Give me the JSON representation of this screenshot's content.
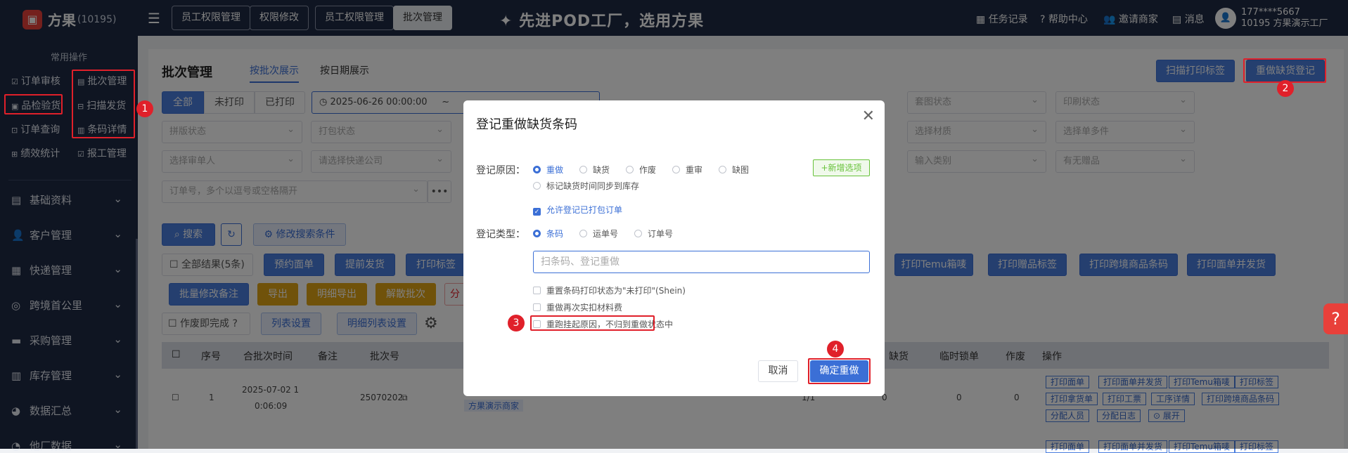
{
  "topbar": {
    "brand": "方果",
    "brand_id": "(10195)",
    "tabs": [
      "员工权限管理",
      "权限修改",
      "员工权限管理",
      "批次管理"
    ],
    "banner": "先进POD工厂，选用方果",
    "task_record": "任务记录",
    "help_center": "帮助中心",
    "invite": "邀请商家",
    "messages": "消息",
    "user_phone": "177****5667",
    "user_company": "10195  方果演示工厂"
  },
  "sidebar": {
    "section_title": "常用操作",
    "quick": [
      "订单审核",
      "批次管理",
      "品检验货",
      "扫描发货",
      "订单查询",
      "条码详情",
      "绩效统计",
      "报工管理"
    ],
    "menu": [
      "基础资料",
      "客户管理",
      "快递管理",
      "跨境首公里",
      "采购管理",
      "库存管理",
      "数据汇总",
      "他厂数据"
    ]
  },
  "page": {
    "title": "批次管理",
    "subtabs": [
      "按批次展示",
      "按日期展示"
    ],
    "btn_scan_print": "扫描打印标签",
    "btn_redo": "重做缺货登记",
    "status_tabs": [
      "全部",
      "未打印",
      "已打印"
    ],
    "date_from": "2025-06-26 00:00:00",
    "date_sep": "~",
    "filters_row1": [
      "套图状态",
      "印刷状态"
    ],
    "filters_row2": [
      "拼版状态",
      "打包状态",
      "选择材质",
      "选择单多件"
    ],
    "filters_row3": [
      "选择审单人",
      "请选择快递公司",
      "输入类别",
      "有无赠品"
    ],
    "order_input_placeholder": "订单号，多个以逗号或空格隔开",
    "more": "•••",
    "search": "搜索",
    "modify_search": "修改搜索条件",
    "select_all": "全部结果(5条)",
    "actions_row1": [
      "预约面单",
      "提前发货",
      "打印标签"
    ],
    "actions_row1_right": [
      "打印Temu箱唛",
      "打印赠品标签",
      "打印跨境商品条码",
      "打印面单并发货"
    ],
    "batch_remark": "批量修改备注",
    "yellow": [
      "导出",
      "明细导出",
      "解散批次"
    ],
    "partial": "分",
    "void_done": "作废即完成",
    "list_settings": "列表设置",
    "detail_settings": "明细列表设置",
    "columns": [
      "序号",
      "合批次时间",
      "备注",
      "批次号",
      "缺货",
      "临时锁单",
      "作废",
      "操作"
    ],
    "row": {
      "index": "1",
      "time1": "2025-07-02 1",
      "time2": "0:06:09",
      "batch_no": "25070202",
      "merchant": "方果演示商家",
      "ratio": "1/1",
      "v1": "0",
      "v2": "0",
      "v3": "0",
      "ops": [
        "打印面单",
        "打印面单并发货",
        "打印Temu箱唛",
        "打印标签",
        "打印拿货单",
        "打印工票",
        "工序详情",
        "打印跨境商品条码",
        "分配人员",
        "分配日志",
        "展开"
      ]
    },
    "next_ops": [
      "打印面单",
      "打印面单并发货",
      "打印Temu箱唛",
      "打印标签"
    ]
  },
  "modal": {
    "title": "登记重做缺货条码",
    "reason_label": "登记原因：",
    "reasons": [
      "重做",
      "缺货",
      "作废",
      "重审",
      "缺图"
    ],
    "add_option": "+新增选项",
    "sync_stock": "标记缺货时间同步到库存",
    "allow_packed": "允许登记已打包订单",
    "type_label": "登记类型：",
    "types": [
      "条码",
      "运单号",
      "订单号"
    ],
    "scan_placeholder": "扫条码、登记重做",
    "opt1": "重置条码打印状态为\"未打印\"(Shein)",
    "opt2": "重做再次实扣材料费",
    "opt3": "重跑挂起原因，不归到重做状态中",
    "cancel": "取消",
    "confirm": "确定重做"
  },
  "annotations": [
    "1",
    "2",
    "3",
    "4"
  ],
  "colors": {
    "accent": "#3b6fd6",
    "sidebar": "#1f2a44",
    "highlight": "#e0202a"
  }
}
